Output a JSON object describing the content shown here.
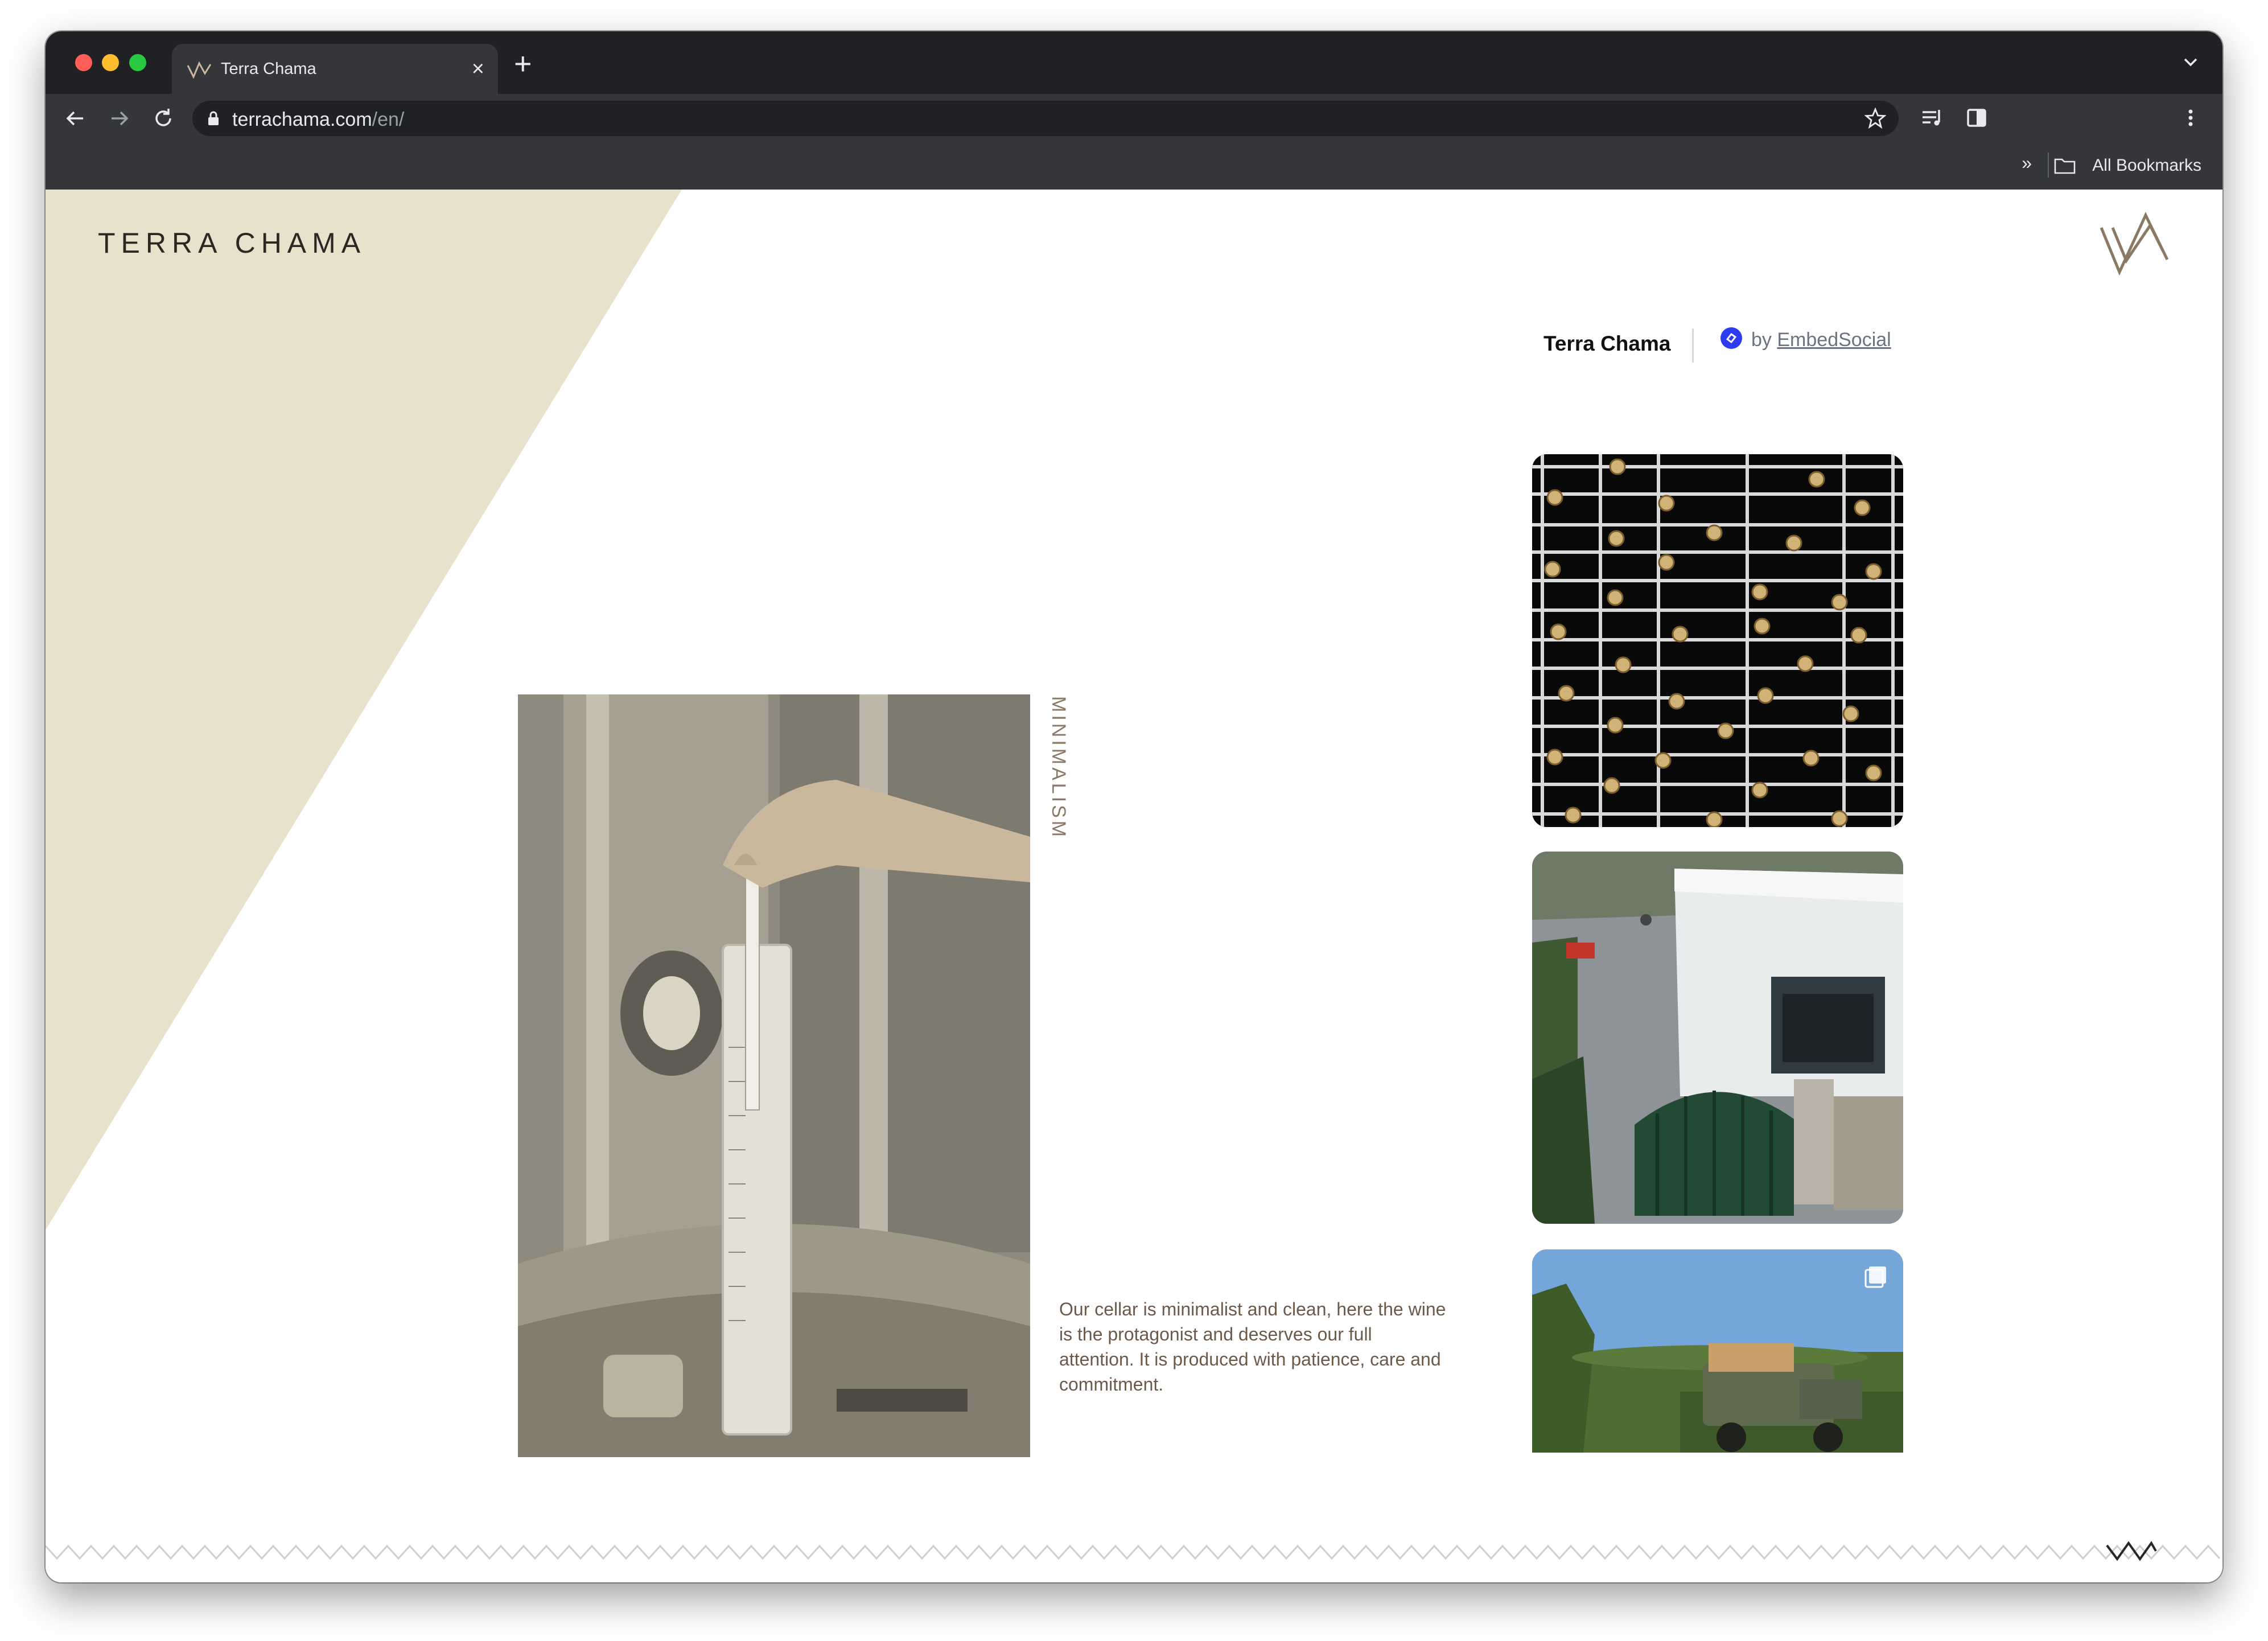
{
  "browser": {
    "tab_title": "Terra Chama",
    "tab_close": "×",
    "new_tab": "+",
    "url_host": "terrachama.com",
    "url_path": "/en/",
    "bookmarks_chevron": "»",
    "bookmarks_label": "All Bookmarks"
  },
  "site": {
    "brand": "TERRA CHAMA",
    "vertical_label": "MINIMALISM",
    "caption": "Our cellar is minimalist and clean, here the wine is the protagonist and deserves our full attention. It is produced with patience, care and commitment."
  },
  "widget": {
    "title": "Terra Chama",
    "by": "by",
    "provider": "EmbedSocial"
  },
  "colors": {
    "beige": "#e8e2cc",
    "brand_text": "#2b2824",
    "accent_brown": "#8a7a64",
    "embed_blue": "#2d3cf0"
  },
  "icons": [
    "back-icon",
    "forward-icon",
    "reload-icon",
    "lock-icon",
    "star-icon",
    "media-icon",
    "sidepanel-icon",
    "menu-icon",
    "folder-icon",
    "logo-mark-icon",
    "multi-image-icon"
  ]
}
